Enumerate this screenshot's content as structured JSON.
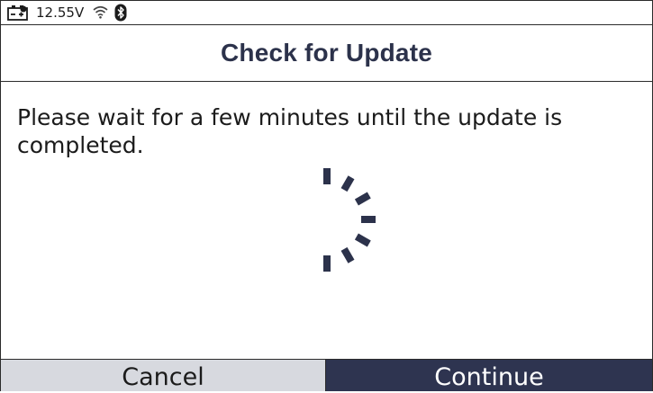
{
  "status_bar": {
    "battery_icon": "battery-plus-icon",
    "voltage": "12.55V",
    "wifi_icon": "wifi-icon",
    "bluetooth_icon": "bluetooth-icon"
  },
  "header": {
    "title": "Check for Update"
  },
  "main": {
    "message": "Please wait for a few minutes until the update is completed.",
    "spinner_icon": "loading-spinner-icon"
  },
  "buttons": {
    "cancel_label": "Cancel",
    "continue_label": "Continue"
  },
  "colors": {
    "accent": "#2e3450",
    "title": "#2c324b",
    "cancel_bg": "#d7d9df"
  }
}
